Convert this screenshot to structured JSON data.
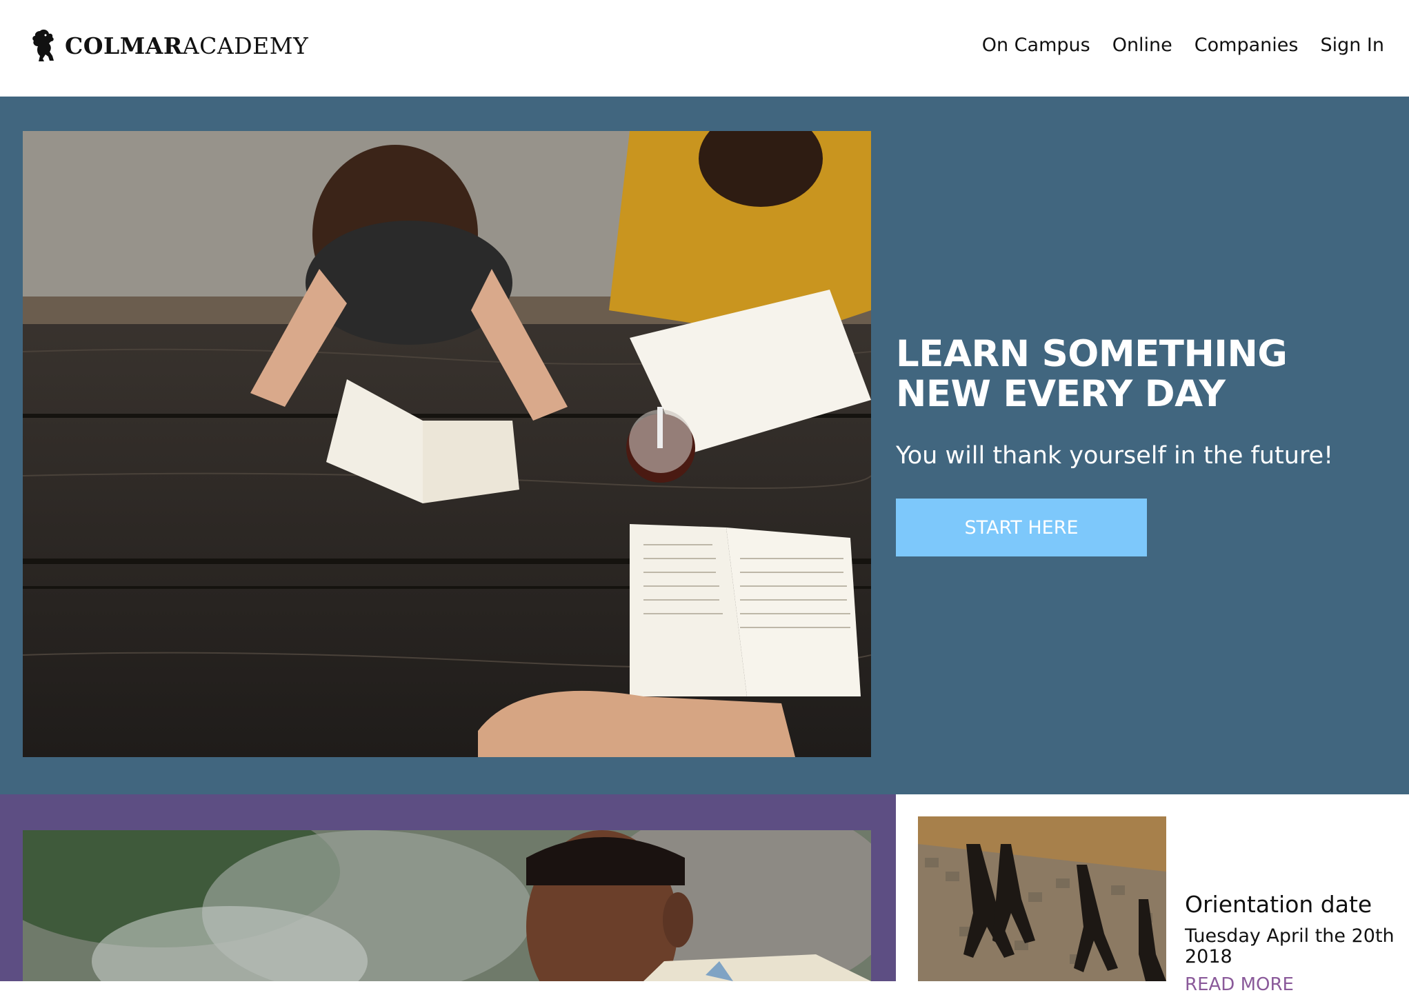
{
  "brand": {
    "name_bold": "COLMAR",
    "name_regular": "ACADEMY",
    "logo_icon": "lion-rampant-icon"
  },
  "nav": {
    "items": [
      {
        "label": "On Campus"
      },
      {
        "label": "Online"
      },
      {
        "label": "Companies"
      },
      {
        "label": "Sign In"
      }
    ]
  },
  "hero": {
    "title": "LEARN SOMETHING NEW EVERY DAY",
    "subtitle": "You will thank yourself in the future!",
    "cta_label": "START HERE",
    "image_alt": "students-studying-at-picnic-table-photo"
  },
  "event": {
    "title": "Orientation date",
    "date": "Tuesday April the 20th 2018",
    "link_label": "READ MORE",
    "image_alt": "people-shadows-on-cobblestone-photo"
  },
  "colors": {
    "hero_bg": "#41667f",
    "lower_bg": "#5d4e83",
    "cta_bg": "#7dc8fb",
    "link": "#8a5a9a"
  }
}
